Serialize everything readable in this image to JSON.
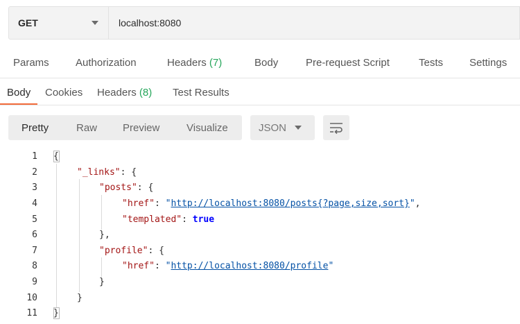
{
  "request": {
    "method": "GET",
    "url": "localhost:8080",
    "tabs": {
      "params": "Params",
      "authorization": "Authorization",
      "headers_label": "Headers",
      "headers_count": "(7)",
      "body": "Body",
      "prerequest": "Pre-request Script",
      "tests": "Tests",
      "settings": "Settings"
    }
  },
  "response": {
    "tabs": {
      "body": "Body",
      "cookies": "Cookies",
      "headers_label": "Headers",
      "headers_count": "(8)",
      "test_results": "Test Results"
    },
    "view_modes": {
      "pretty": "Pretty",
      "raw": "Raw",
      "preview": "Preview",
      "visualize": "Visualize"
    },
    "format": "JSON",
    "line_numbers": [
      "1",
      "2",
      "3",
      "4",
      "5",
      "6",
      "7",
      "8",
      "9",
      "10",
      "11"
    ],
    "code": {
      "l1": "{",
      "l2_key": "\"_links\"",
      "l2_rest": ": {",
      "l3_key": "\"posts\"",
      "l3_rest": ": {",
      "l4_key": "\"href\"",
      "l4_sep": ": ",
      "l4_q1": "\"",
      "l4_link": "http://localhost:8080/posts{?page,size,sort}",
      "l4_q2": "\"",
      "l4_end": ",",
      "l5_key": "\"templated\"",
      "l5_sep": ": ",
      "l5_val": "true",
      "l6": "},",
      "l7_key": "\"profile\"",
      "l7_rest": ": {",
      "l8_key": "\"href\"",
      "l8_sep": ": ",
      "l8_q1": "\"",
      "l8_link": "http://localhost:8080/profile",
      "l8_q2": "\"",
      "l9": "}",
      "l10": "}",
      "l11": "}"
    }
  },
  "colors": {
    "accent": "#f26b3a",
    "count_green": "#26a65b",
    "json_key": "#a31515",
    "json_string": "#0451a5",
    "json_bool": "#0000ff"
  },
  "icons": {
    "method_dropdown": "chevron-down-icon",
    "format_dropdown": "chevron-down-icon",
    "wrap": "wrap-lines-icon"
  }
}
